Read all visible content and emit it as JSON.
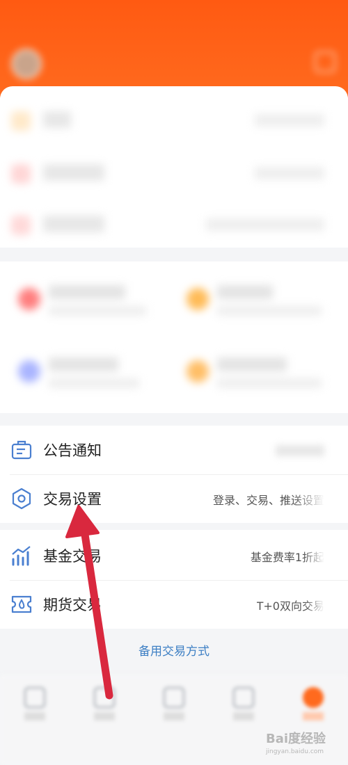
{
  "list_section": {
    "items": [
      {
        "label": "公告通知",
        "value": "",
        "icon": "announcement-icon"
      },
      {
        "label": "交易设置",
        "value": "登录、交易、推送设置",
        "icon": "hexagon-settings-icon"
      }
    ]
  },
  "trade_section": {
    "items": [
      {
        "label": "基金交易",
        "value": "基金费率1折起",
        "icon": "bar-chart-icon"
      },
      {
        "label": "期货交易",
        "value": "T+0双向交易",
        "icon": "ticket-icon"
      }
    ]
  },
  "alt_trade_link": "备用交易方式",
  "watermark": {
    "text": "Bai度经验",
    "url": "jingyan.baidu.com"
  },
  "colors": {
    "header": "#ff5a12",
    "icon_blue": "#4a7fd0",
    "link": "#3d7fc4",
    "arrow": "#d9283e"
  }
}
